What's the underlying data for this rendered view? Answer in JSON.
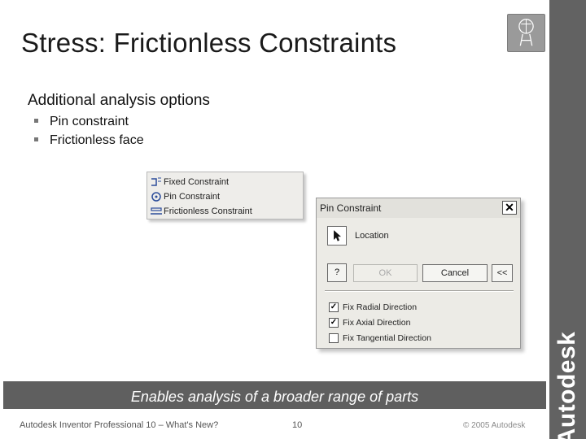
{
  "slide": {
    "title": "Stress: Frictionless Constraints",
    "heading": "Additional analysis options",
    "bullets": [
      "Pin constraint",
      "Frictionless face"
    ]
  },
  "menu": {
    "items": [
      {
        "label": "Fixed Constraint",
        "icon": "fixed-constraint-icon"
      },
      {
        "label": "Pin Constraint",
        "icon": "pin-constraint-icon"
      },
      {
        "label": "Frictionless Constraint",
        "icon": "frictionless-constraint-icon"
      }
    ]
  },
  "dialog": {
    "title": "Pin Constraint",
    "close_label": "✕",
    "location_label": "Location",
    "help_label": "?",
    "ok_label": "OK",
    "cancel_label": "Cancel",
    "expand_label": "<<",
    "options": [
      {
        "label": "Fix Radial Direction",
        "checked": true,
        "check": "✓"
      },
      {
        "label": "Fix Axial Direction",
        "checked": true,
        "check": "✓"
      },
      {
        "label": "Fix Tangential Direction",
        "checked": false,
        "check": ""
      }
    ]
  },
  "footer": {
    "caption": "Enables analysis of a broader range of parts",
    "left": "Autodesk Inventor Professional 10 – What's New?",
    "page": "10",
    "right": "© 2005 Autodesk"
  },
  "brand": {
    "name": "Autodesk"
  },
  "colors": {
    "side_bar": "#626262",
    "caption_band": "#5f5f5f",
    "dialog_bg": "#ecebe6"
  }
}
